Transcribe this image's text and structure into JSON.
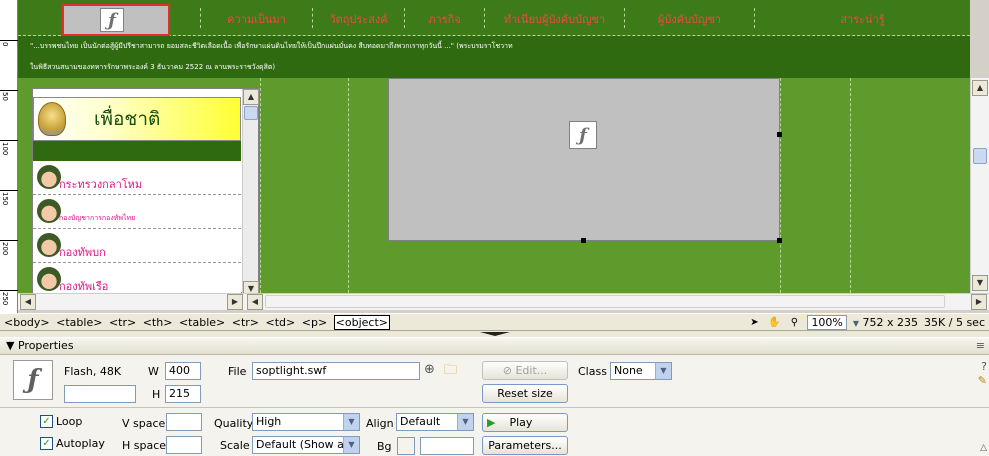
{
  "site": {
    "nav": [
      "ความเป็นมา",
      "วัตถุประสงค์",
      "ภารกิจ",
      "ทำเนียบผู้บังคับบัญชา",
      "ผู้บังคับบัญชา",
      "สาระน่ารู้"
    ],
    "quote_line1": "\"...บรรพชนไทย เป็นนักต่อสู้ผู้มีปรีชาสามารถ ยอมสละชีวิตเลือดเนื้อ เพื่อรักษาแผ่นดินไทยให้เป็นปึกแผ่นมั่นคง สืบทอดมาถึงพวกเราทุกวันนี้ ...\" (พระบรมราโชวาท",
    "quote_line2": "ในพิธีสวนสนามของทหารรักษาพระองค์ 3 ธันวาคม 2522 ณ ลานพระราชวังดุสิต)",
    "banner_text": "เพื่อชาติ",
    "menu": [
      "กระทรวงกลาโหม",
      "กองบัญชาการกองทัพไทย",
      "กองทัพบก",
      "กองทัพเรือ"
    ]
  },
  "statusbar": {
    "tags": [
      "<body>",
      "<table>",
      "<tr>",
      "<th>",
      "<table>",
      "<tr>",
      "<td>",
      "<p>"
    ],
    "current_tag": "<object>",
    "zoom": "100%",
    "size": "752 x 235",
    "weight": "35K / 5 sec"
  },
  "properties": {
    "title": "Properties",
    "type_label": "Flash, 48K",
    "w_label": "W",
    "w_value": "400",
    "h_label": "H",
    "h_value": "215",
    "name_value": "",
    "file_label": "File",
    "file_value": "soptlight.swf",
    "edit_label": "Edit...",
    "reset_label": "Reset size",
    "class_label": "Class",
    "class_value": "None",
    "loop_label": "Loop",
    "autoplay_label": "Autoplay",
    "vspace_label": "V space",
    "hspace_label": "H space",
    "vspace_value": "",
    "hspace_value": "",
    "quality_label": "Quality",
    "quality_value": "High",
    "scale_label": "Scale",
    "scale_value": "Default (Show all)",
    "align_label": "Align",
    "align_value": "Default",
    "bg_label": "Bg",
    "bg_value": "",
    "play_label": "Play",
    "params_label": "Parameters...",
    "ruler_labels": [
      "0",
      "50",
      "100",
      "150",
      "200",
      "250"
    ]
  },
  "colors": {
    "page_green": "#5f9a2c",
    "dark_green": "#2f6a10",
    "nav_text": "#f44646",
    "menu_text": "#e0158a"
  }
}
